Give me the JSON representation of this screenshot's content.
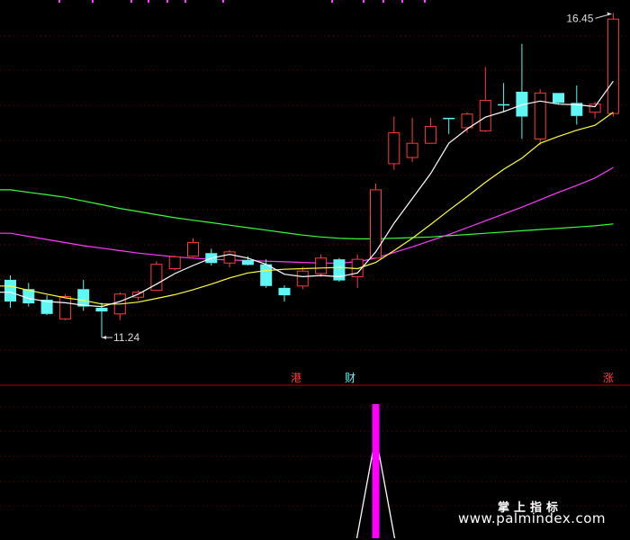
{
  "chart_data": {
    "type": "candlestick",
    "colors": {
      "up": "#ff3b3b",
      "down": "#5ff6f6",
      "ma5": "#ffffff",
      "ma10": "#ffff3b",
      "ma20": "#ff3bff",
      "ma60": "#3bff3b",
      "grid": "#7a0000",
      "signal": "#ff00ff"
    },
    "price_range": [
      10.8,
      16.6
    ],
    "candles": [
      {
        "o": 12.15,
        "h": 12.22,
        "l": 11.7,
        "c": 11.8
      },
      {
        "o": 12.0,
        "h": 12.1,
        "l": 11.72,
        "c": 11.77
      },
      {
        "o": 11.83,
        "h": 11.9,
        "l": 11.58,
        "c": 11.6
      },
      {
        "o": 11.52,
        "h": 11.92,
        "l": 11.5,
        "c": 11.88
      },
      {
        "o": 12.0,
        "h": 12.15,
        "l": 11.65,
        "c": 11.72
      },
      {
        "o": 11.7,
        "h": 11.78,
        "l": 11.22,
        "c": 11.64
      },
      {
        "o": 11.6,
        "h": 11.95,
        "l": 11.5,
        "c": 11.92
      },
      {
        "o": 11.87,
        "h": 11.98,
        "l": 11.82,
        "c": 11.95
      },
      {
        "o": 11.98,
        "h": 12.45,
        "l": 11.98,
        "c": 12.4
      },
      {
        "o": 12.33,
        "h": 12.54,
        "l": 12.3,
        "c": 12.52
      },
      {
        "o": 12.53,
        "h": 12.82,
        "l": 12.52,
        "c": 12.75
      },
      {
        "o": 12.58,
        "h": 12.65,
        "l": 12.38,
        "c": 12.42
      },
      {
        "o": 12.42,
        "h": 12.63,
        "l": 12.35,
        "c": 12.6
      },
      {
        "o": 12.47,
        "h": 12.53,
        "l": 12.38,
        "c": 12.39
      },
      {
        "o": 12.4,
        "h": 12.48,
        "l": 12.02,
        "c": 12.05
      },
      {
        "o": 12.02,
        "h": 12.06,
        "l": 11.8,
        "c": 11.9
      },
      {
        "o": 12.05,
        "h": 12.36,
        "l": 12.0,
        "c": 12.29
      },
      {
        "o": 12.25,
        "h": 12.56,
        "l": 12.2,
        "c": 12.5
      },
      {
        "o": 12.48,
        "h": 12.5,
        "l": 12.12,
        "c": 12.14
      },
      {
        "o": 12.2,
        "h": 12.56,
        "l": 12.02,
        "c": 12.48
      },
      {
        "o": 12.5,
        "h": 13.7,
        "l": 12.5,
        "c": 13.6
      },
      {
        "o": 14.02,
        "h": 14.78,
        "l": 13.92,
        "c": 14.52
      },
      {
        "o": 14.12,
        "h": 14.76,
        "l": 14.05,
        "c": 14.35
      },
      {
        "o": 14.35,
        "h": 14.76,
        "l": 14.35,
        "c": 14.62
      },
      {
        "o": 14.76,
        "h": 14.76,
        "l": 14.5,
        "c": 14.74
      },
      {
        "o": 14.6,
        "h": 14.85,
        "l": 14.52,
        "c": 14.82
      },
      {
        "o": 14.55,
        "h": 15.58,
        "l": 14.53,
        "c": 15.04
      },
      {
        "o": 14.98,
        "h": 15.32,
        "l": 14.85,
        "c": 14.96
      },
      {
        "o": 15.18,
        "h": 15.95,
        "l": 14.42,
        "c": 14.78
      },
      {
        "o": 14.42,
        "h": 15.22,
        "l": 14.32,
        "c": 15.16
      },
      {
        "o": 15.16,
        "h": 15.16,
        "l": 14.99,
        "c": 15.0
      },
      {
        "o": 15.0,
        "h": 15.28,
        "l": 14.65,
        "c": 14.79
      },
      {
        "o": 14.85,
        "h": 15.02,
        "l": 14.75,
        "c": 14.98
      },
      {
        "o": 14.83,
        "h": 16.45,
        "l": 14.78,
        "c": 16.35
      }
    ],
    "ma5": [
      11.95,
      11.85,
      11.8,
      11.78,
      11.74,
      11.72,
      11.8,
      11.92,
      12.08,
      12.25,
      12.38,
      12.5,
      12.56,
      12.5,
      12.4,
      12.24,
      12.2,
      12.22,
      12.2,
      12.26,
      12.6,
      13.06,
      13.46,
      13.86,
      14.35,
      14.58,
      14.77,
      14.86,
      14.97,
      15.03,
      14.98,
      14.97,
      14.94,
      15.35
    ],
    "ma10": [
      12.05,
      11.98,
      11.92,
      11.86,
      11.82,
      11.76,
      11.76,
      11.79,
      11.85,
      11.91,
      11.99,
      12.08,
      12.18,
      12.26,
      12.3,
      12.32,
      12.33,
      12.34,
      12.35,
      12.33,
      12.43,
      12.62,
      12.82,
      13.04,
      13.27,
      13.49,
      13.72,
      13.93,
      14.11,
      14.35,
      14.46,
      14.56,
      14.64,
      14.85
    ],
    "ma20": [
      12.9,
      12.85,
      12.8,
      12.75,
      12.7,
      12.66,
      12.62,
      12.58,
      12.55,
      12.52,
      12.5,
      12.48,
      12.47,
      12.46,
      12.45,
      12.44,
      12.43,
      12.42,
      12.42,
      12.44,
      12.5,
      12.59,
      12.68,
      12.78,
      12.88,
      12.99,
      13.1,
      13.21,
      13.32,
      13.44,
      13.56,
      13.67,
      13.79,
      13.96
    ],
    "ma60": [
      13.6,
      13.56,
      13.52,
      13.48,
      13.42,
      13.36,
      13.3,
      13.25,
      13.2,
      13.15,
      13.11,
      13.07,
      13.03,
      12.99,
      12.95,
      12.91,
      12.87,
      12.84,
      12.82,
      12.81,
      12.81,
      12.82,
      12.83,
      12.84,
      12.86,
      12.88,
      12.9,
      12.92,
      12.94,
      12.96,
      12.98,
      13.0,
      13.02,
      13.05
    ],
    "annotations": {
      "high_label": "16.45",
      "low_label": "11.24",
      "tag_gang": "港",
      "tag_cai": "财",
      "tag_zhang": "涨"
    },
    "signal": {
      "index": 20,
      "value": 1
    }
  },
  "watermark": {
    "line1": "掌上指标",
    "line2": "www.palmindex.com"
  }
}
